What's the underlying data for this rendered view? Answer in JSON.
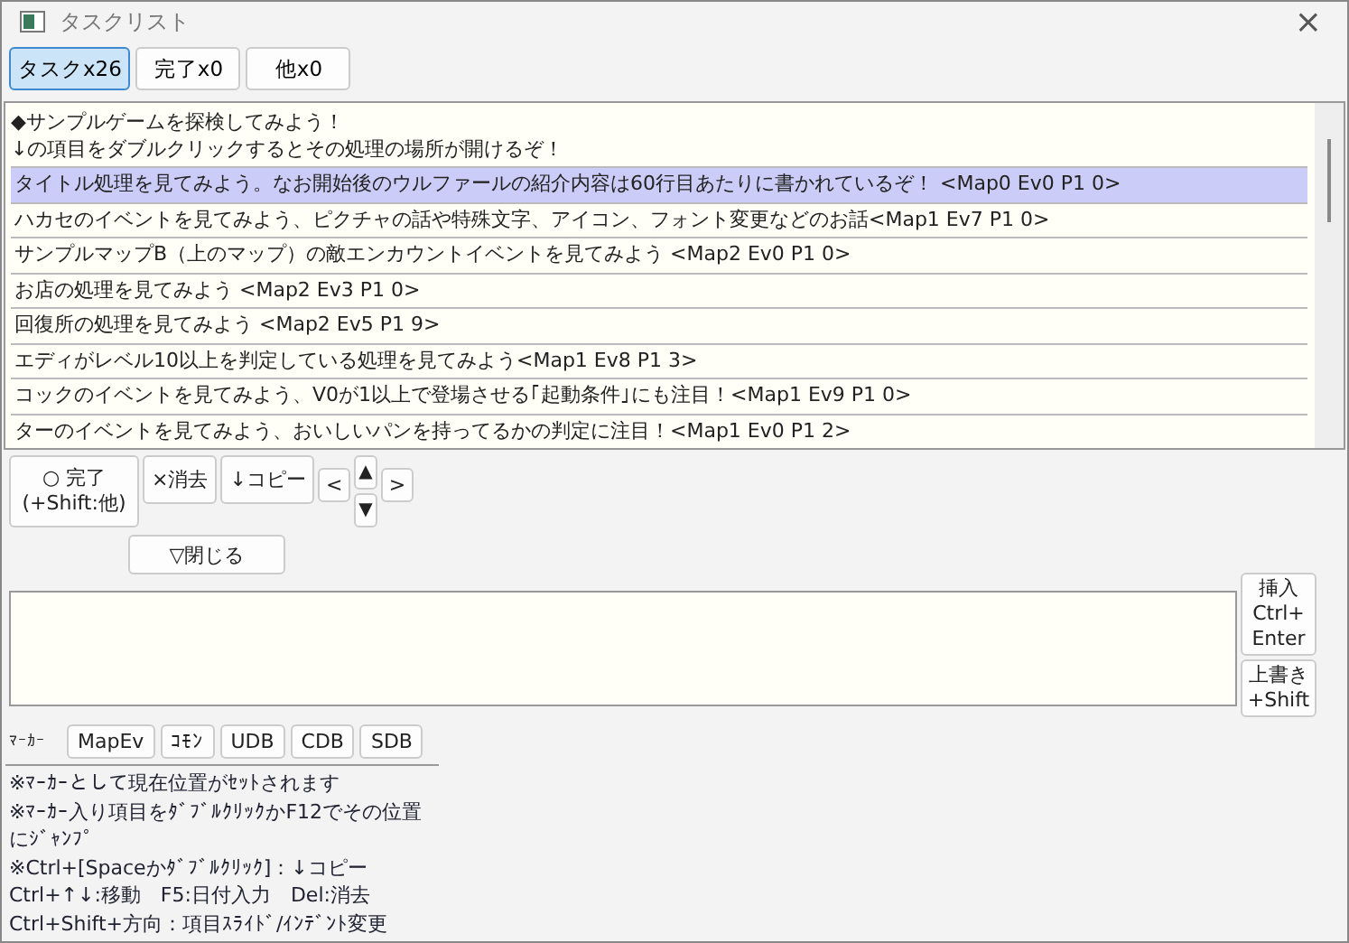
{
  "window": {
    "title": "タスクリスト",
    "close": "×"
  },
  "tabs": [
    {
      "label": "タスクx26",
      "selected": true
    },
    {
      "label": "完了x0",
      "selected": false
    },
    {
      "label": "他x0",
      "selected": false
    }
  ],
  "items": [
    {
      "kind": "note",
      "lines": [
        "◆サンプルゲームを探検してみよう！",
        "↓の項目をダブルクリックするとその処理の場所が開けるぞ！"
      ],
      "selected": false
    },
    {
      "kind": "task",
      "lines": [
        "タイトル処理を見てみよう。なお開始後のウルファールの紹介内容は60行目あたりに書かれているぞ！ <Map0 Ev0 P1 0>"
      ],
      "selected": true
    },
    {
      "kind": "task",
      "lines": [
        "ハカセのイベントを見てみよう、ピクチャの話や特殊文字、アイコン、フォント変更などのお話<Map1 Ev7 P1 0>"
      ],
      "selected": false
    },
    {
      "kind": "task",
      "lines": [
        "サンプルマップB（上のマップ）の敵エンカウントイベントを見てみよう <Map2 Ev0 P1 0>"
      ],
      "selected": false
    },
    {
      "kind": "task",
      "lines": [
        "お店の処理を見てみよう <Map2 Ev3 P1 0>"
      ],
      "selected": false
    },
    {
      "kind": "task",
      "lines": [
        "回復所の処理を見てみよう <Map2 Ev5 P1 9>"
      ],
      "selected": false
    },
    {
      "kind": "task",
      "lines": [
        "エディがレベル10以上を判定している処理を見てみよう<Map1 Ev8 P1 3>"
      ],
      "selected": false
    },
    {
      "kind": "task",
      "lines": [
        "コックのイベントを見てみよう、V0が1以上で登場させる｢起動条件｣にも注目！<Map1 Ev9 P1 0>"
      ],
      "selected": false
    },
    {
      "kind": "task",
      "lines": [
        "ターのイベントを見てみよう、おいしいパンを持ってるかの判定に注目！<Map1 Ev0 P1 2>"
      ],
      "selected": false
    }
  ],
  "actions": {
    "done": [
      "○ 完了",
      "(+Shift:他)"
    ],
    "delete": "×消去",
    "copy": "↓コピー",
    "left": "<",
    "up": "▲",
    "down": "▼",
    "right": ">",
    "close": "▽閉じる"
  },
  "insert_buttons": [
    [
      "挿入",
      "Ctrl+",
      "Enter"
    ],
    [
      "上書き",
      "+Shift"
    ]
  ],
  "marker": {
    "label": "ﾏｰｶｰ",
    "buttons": [
      "MapEv",
      "ｺﾓﾝ",
      "UDB",
      "CDB",
      "SDB"
    ]
  },
  "help": [
    "※ﾏｰｶｰとして現在位置がｾｯﾄされます",
    "※ﾏｰｶｰ入り項目をﾀﾞﾌﾞﾙｸﾘｯｸかF12でその位置にｼﾞｬﾝﾌﾟ",
    "※Ctrl+[Spaceかﾀﾞﾌﾞﾙｸﾘｯｸ]：↓コピー",
    " Ctrl+↑↓:移動　F5:日付入力　Del:消去",
    " Ctrl+Shift+方向：項目ｽﾗｲﾄﾞ/ｲﾝﾃﾞﾝﾄ変更"
  ]
}
